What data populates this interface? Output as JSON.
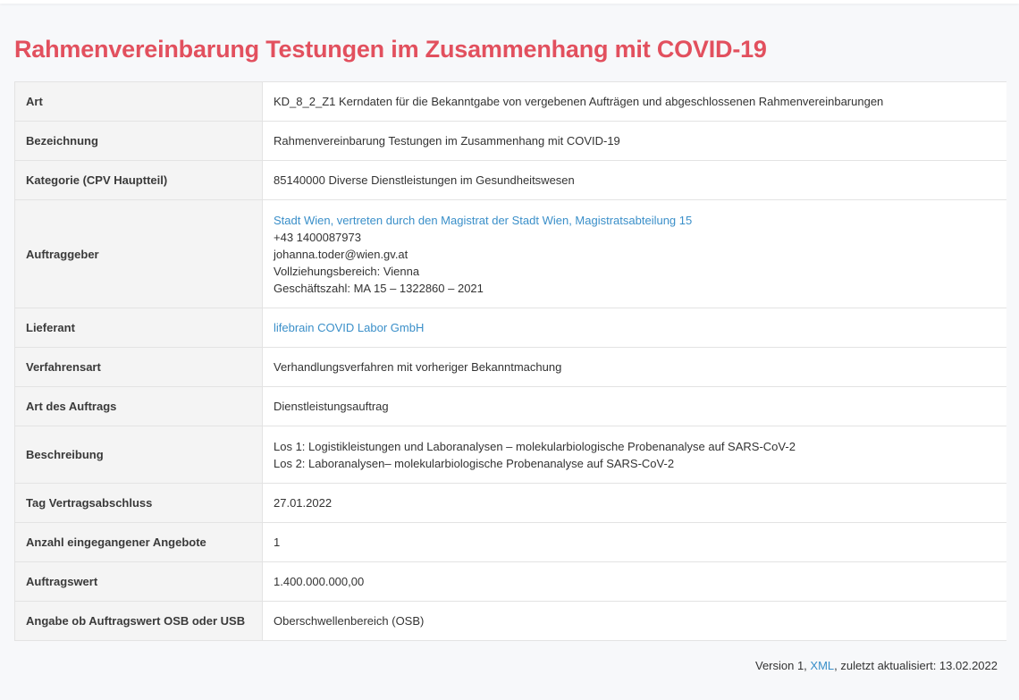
{
  "page": {
    "title": "Rahmenvereinbarung Testungen im Zusammenhang mit COVID-19"
  },
  "rows": {
    "art": {
      "label": "Art",
      "value": "KD_8_2_Z1 Kerndaten für die Bekanntgabe von vergebenen Aufträgen und abgeschlossenen Rahmenvereinbarungen"
    },
    "bezeichnung": {
      "label": "Bezeichnung",
      "value": "Rahmenvereinbarung Testungen im Zusammenhang mit COVID-19"
    },
    "kategorie": {
      "label": "Kategorie (CPV Hauptteil)",
      "value": "85140000 Diverse Dienstleistungen im Gesundheitswesen"
    },
    "auftraggeber": {
      "label": "Auftraggeber",
      "name_link": "Stadt Wien, vertreten durch den Magistrat der Stadt Wien, Magistratsabteilung 15",
      "phone": "+43 1400087973",
      "email": "johanna.toder@wien.gv.at",
      "bereich": "Vollziehungsbereich: Vienna",
      "geschaeftszahl": "Geschäftszahl: MA 15 – 1322860 – 2021"
    },
    "lieferant": {
      "label": "Lieferant",
      "value_link": "lifebrain COVID Labor GmbH"
    },
    "verfahrensart": {
      "label": "Verfahrensart",
      "value": "Verhandlungsverfahren mit vorheriger Bekanntmachung"
    },
    "art_auftrag": {
      "label": "Art des Auftrags",
      "value": "Dienstleistungsauftrag"
    },
    "beschreibung": {
      "label": "Beschreibung",
      "line1": "Los 1: Logistikleistungen und Laboranalysen – molekularbiologische Probenanalyse auf SARS-CoV-2",
      "line2": "Los 2: Laboranalysen– molekularbiologische Probenanalyse auf SARS-CoV-2"
    },
    "tag": {
      "label": "Tag Vertragsabschluss",
      "value": "27.01.2022"
    },
    "angebote": {
      "label": "Anzahl eingegangener Angebote",
      "value": "1"
    },
    "auftragswert": {
      "label": "Auftragswert",
      "value": "1.400.000.000,00"
    },
    "osb": {
      "label": "Angabe ob Auftragswert OSB oder USB",
      "value": "Oberschwellenbereich (OSB)"
    }
  },
  "footer": {
    "prefix": "Version 1, ",
    "xml_link": "XML",
    "suffix": ", zuletzt aktualisiert: 13.02.2022"
  },
  "colors": {
    "title": "#e2505e",
    "link": "#3a8fc9",
    "label_bg": "#f4f4f4"
  }
}
